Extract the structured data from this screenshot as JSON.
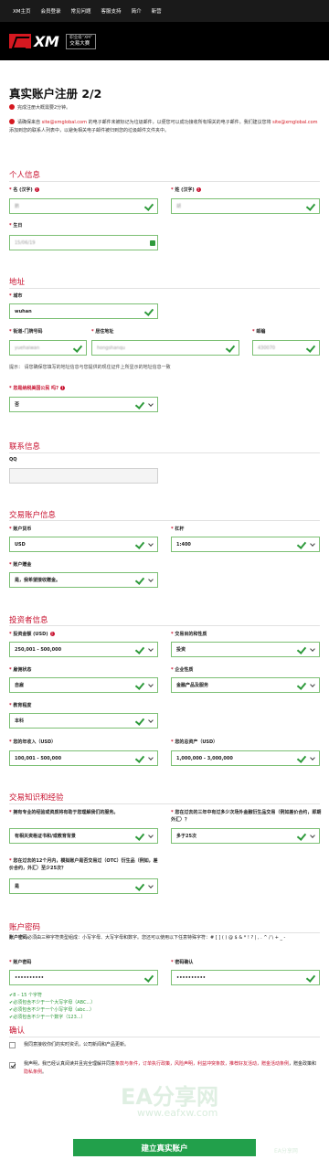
{
  "nav": [
    "XM主页",
    "会员登录",
    "常见问题",
    "客服支持",
    "简介",
    "新营"
  ],
  "brand": {
    "name": "XM",
    "badge_line1": "职业级“XM”",
    "badge_line2": "交易大赛"
  },
  "page_title": "真实账户注册 2/2",
  "notes": {
    "time": "完成注册大概需要2分钟。",
    "email_a": "请确保来自 ",
    "email_link1": "site@xmglobal.com",
    "email_b": " 的电子邮件未被标记为垃圾邮件，以便您可以成功接收所有相关的电子邮件。我们建议您将 ",
    "email_link2": "site@xmglobal.com",
    "email_c": "添加到您的联系人列表中，以避免相关电子邮件被归到您的垃圾邮件文件夹中。"
  },
  "personal": {
    "title": "个人信息",
    "first_name_label": "名 (汉字)",
    "first_name_value": "鹏",
    "last_name_label": "姓 (汉字)",
    "last_name_value": "胡",
    "dob_label": "生日",
    "dob_value": "15/06/19"
  },
  "address": {
    "title": "地址",
    "city_label": "城市",
    "city_value": "wuhan",
    "street_label": "街道-门牌号码",
    "street_value": "yuehaiwan",
    "residence_label": "居住地址",
    "residence_value": "hongshanqu",
    "zip_label": "邮编",
    "zip_value": "430070",
    "hint": "提示： 请您确保您填写的地址信息与您提供的现住证件上所显示的地址信息一致",
    "us_label": "您是纳税美国公民 吗?",
    "us_value": "否"
  },
  "contact": {
    "title": "联系信息",
    "qq_label": "QQ",
    "qq_value": ""
  },
  "trading": {
    "title": "交易账户信息",
    "currency_label": "账户货币",
    "currency_value": "USD",
    "leverage_label": "杠杆",
    "leverage_value": "1:400",
    "bonus_label": "账户赠金",
    "bonus_value": "是，我希望接收赠金。"
  },
  "investor": {
    "title": "投资者信息",
    "amount_label": "投资金额 (USD)",
    "amount_value": "250,001 - 500,000",
    "purpose_label": "交易目的和性质",
    "purpose_value": "投资",
    "employment_label": "雇佣状态",
    "employment_value": "自雇",
    "industry_label": "企业性质",
    "industry_value": "金融产品及服务",
    "education_label": "教育程度",
    "education_value": "本科",
    "income_label": "您的年收入（USD）",
    "income_value": "100,001 - 500,000",
    "networth_label": "您的总资产（USD）",
    "networth_value": "1,000,000 - 3,000,000"
  },
  "knowledge": {
    "title": "交易知识和经验",
    "q1_label": "拥有专业的经验或资质将有助于您理解我们的服务。",
    "q1_value": "有相关资格证书和/或教育背景",
    "q2_label": "您在过去的三年中有过多少次场外金融衍生品交易（例如差价合约，即期外汇）？",
    "q2_value": "多于25次",
    "q3_label": "您在过去的12个月内，模拟账户是否交易过（OTC）衍生品（例如，差价合约，外汇）至少25次？",
    "q3_value": "是"
  },
  "password": {
    "title": "账户密码",
    "desc_bold": "账户密码",
    "desc": "必须由三种字符类型组成：小写字母、大写字母和数字。您还可以使用以下任意特殊字符：# [ ] ( ) @ $ & * ! ? | , . ^ / \\ + _ -",
    "pw_label": "账户密码",
    "pw_value": "••••••••••",
    "confirm_label": "密码确认",
    "confirm_value": "••••••••••",
    "rules": [
      "8 – 15 个字符",
      "必须包含不少于一个大写字母（ABC...）",
      "必须包含不少于一个小写字母（abc...）",
      "必须包含不少于一个数字（123...）"
    ]
  },
  "confirm": {
    "title": "确认",
    "opt_in": "我同意接收你们的实时资讯，公司新闻和产品更新。",
    "terms_a": "我声明，我已经认真阅读并且完全理解并同意",
    "terms_b": "条款与条件，订单执行政策，风险声明，利益冲突条款，推荐好友活动，赠金活动条例",
    "terms_c": "，赠金政策和",
    "terms_d": "隐私条例",
    "terms_e": "。"
  },
  "submit_label": "建立真实账户",
  "watermark": {
    "main": "EA分享网",
    "url": "www.eafxw.com",
    "corner": "EA分享网"
  }
}
